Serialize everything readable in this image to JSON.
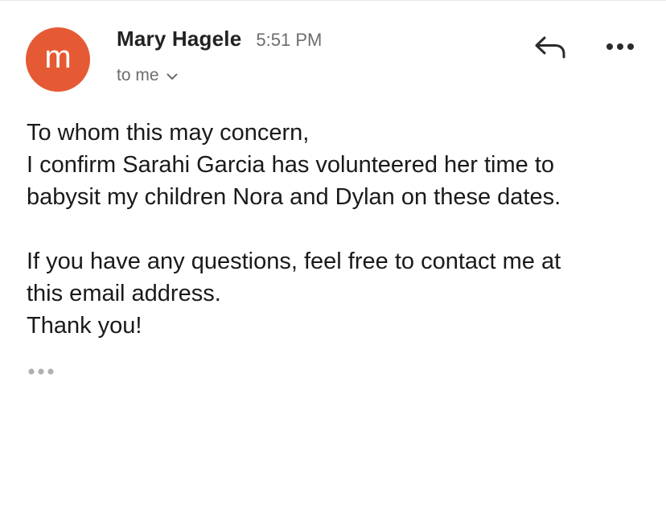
{
  "sender": {
    "avatar_letter": "m",
    "avatar_color": "#e55a34",
    "name": "Mary Hagele",
    "time": "5:51 PM"
  },
  "recipient": {
    "label": "to me",
    "expand_icon": "chevron-down-icon"
  },
  "actions": {
    "reply_icon": "reply-icon",
    "more_icon": "more-horizontal-icon"
  },
  "message": {
    "greeting": "To whom this may concern,",
    "line1": "I confirm Sarahi Garcia has volunteered her time to",
    "line2": "babysit my children Nora and Dylan on these dates.",
    "line3": "If you have any questions, feel free to contact me at",
    "line4": "this email address.",
    "closing": "Thank you!"
  },
  "trimmed_content_icon": "more-horizontal-icon"
}
